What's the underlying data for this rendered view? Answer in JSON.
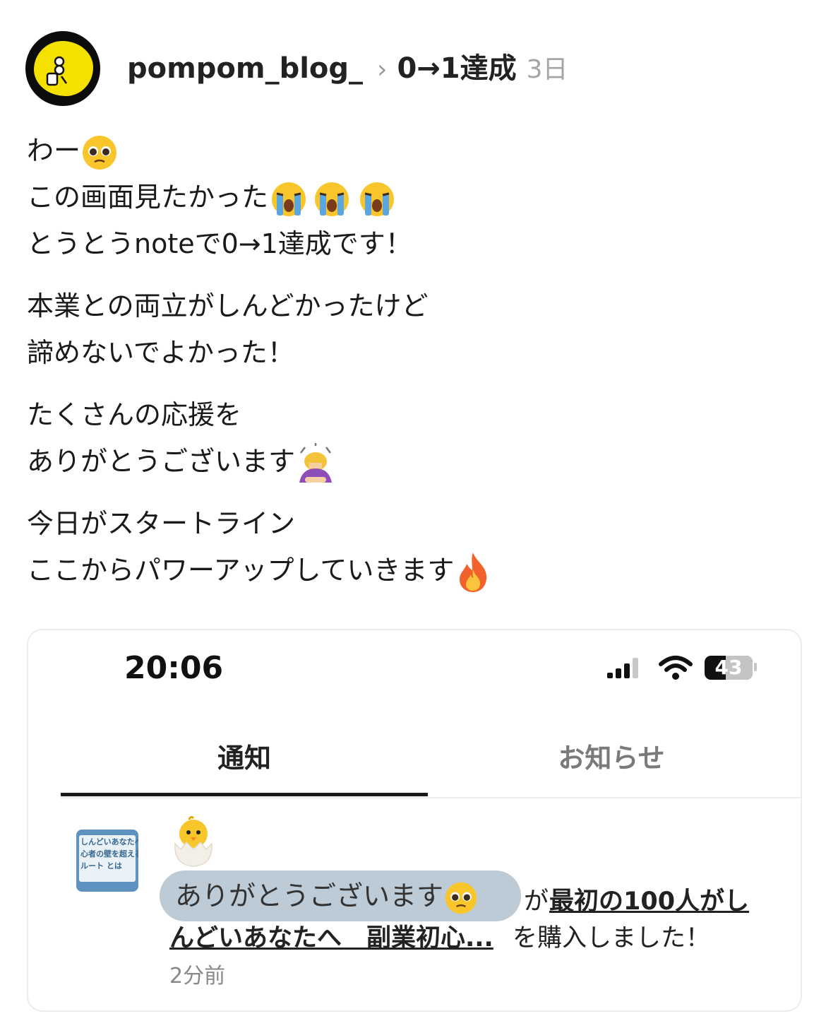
{
  "post": {
    "username": "pompom_blog_",
    "chevron": "›",
    "title": "0→1達成",
    "time_ago": "3日",
    "paragraphs": [
      [
        "わー",
        "この画面見たかった",
        "とうとうnoteで0→1達成です！"
      ],
      [
        "本業との両立がしんどかったけど",
        "諦めないでよかった！"
      ],
      [
        "たくさんの応援を",
        "ありがとうございます"
      ],
      [
        "今日がスタートライン",
        "ここからパワーアップしていきます"
      ]
    ]
  },
  "screenshot": {
    "status_time": "20:06",
    "battery": "43",
    "tabs": [
      "通知",
      "お知らせ"
    ],
    "active_tab": 0,
    "thumbnail_lines": [
      "しんどいあなたへ",
      "心者の壁を超える",
      "ルート とは"
    ],
    "bubble_text": "ありがとうございます",
    "notif_ga": "が",
    "notif_link_line1": "最初の100人がし",
    "notif_link_line2": "んどいあなたへ　副業初心...",
    "notif_tail": "を購入しました！",
    "notif_time": "2分前"
  },
  "icons": {
    "pleading": "pleading-face-icon",
    "crying": "loudly-crying-face-icon",
    "bowing": "woman-bowing-icon",
    "fire": "fire-icon",
    "chick": "hatching-chick-icon",
    "signal": "signal-icon",
    "wifi": "wifi-icon",
    "battery": "battery-icon"
  },
  "colors": {
    "avatar_yellow": "#f5e100",
    "bubble_bg": "#bccbd6",
    "thumb_blue": "#5f93bf"
  }
}
